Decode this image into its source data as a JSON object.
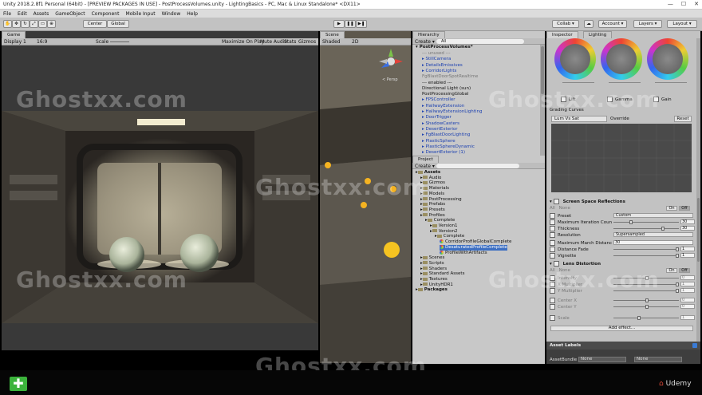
{
  "window": {
    "title": "Unity 2018.2.8f1 Personal (64bit) - [PREVIEW PACKAGES IN USE] - PostProcessVolumes.unity - LightingBasics - PC, Mac & Linux Standalone* <DX11>",
    "controls": [
      "—",
      "☐",
      "✕"
    ]
  },
  "menu": [
    "File",
    "Edit",
    "Assets",
    "GameObject",
    "Component",
    "Mobile Input",
    "Window",
    "Help"
  ],
  "toolbar": {
    "center_label": "Center",
    "global_label": "Global",
    "collab_label": "Collab ▾",
    "account_label": "Account ▾",
    "layers_label": "Layers ▾",
    "layout_label": "Layout ▾"
  },
  "game_view": {
    "tab": "Game",
    "display": "Display 1",
    "aspect": "16:9",
    "scale_label": "Scale",
    "maximize_on_play": "Maximize On Play",
    "mute_audio": "Mute Audio",
    "stats": "Stats",
    "gizmos": "Gizmos"
  },
  "scene_view": {
    "tab": "Scene",
    "shading": "Shaded",
    "mode_2d": "2D",
    "persp": "< Persp"
  },
  "hierarchy": {
    "tab": "Hierarchy",
    "create": "Create ▾",
    "search_placeholder": "All",
    "scene_name": "PostProcessVolumes*",
    "items": [
      {
        "label": "--- unused ---",
        "style": "gray"
      },
      {
        "label": "StillCamera",
        "style": "blue"
      },
      {
        "label": "DetailsEmissives",
        "style": "blue"
      },
      {
        "label": "CorridorLights",
        "style": "blue"
      },
      {
        "label": "FgBlastDoorSpotRealtime",
        "style": "gray"
      },
      {
        "label": "--- enabled ---",
        "style": ""
      },
      {
        "label": "Directional Light (sun)",
        "style": ""
      },
      {
        "label": "PostProcessingGlobal",
        "style": ""
      },
      {
        "label": "FPSController",
        "style": "blue"
      },
      {
        "label": "HallwayExtension",
        "style": "blue"
      },
      {
        "label": "HallwayExtensionLighting",
        "style": "blue"
      },
      {
        "label": "DoorTrigger",
        "style": "blue"
      },
      {
        "label": "ShadowCasters",
        "style": "blue"
      },
      {
        "label": "DesertExterior",
        "style": "blue"
      },
      {
        "label": "FgBlastDoorLighting",
        "style": "blue"
      },
      {
        "label": "PlasticSphere",
        "style": "blue"
      },
      {
        "label": "PlasticSphereDynamic",
        "style": "blue"
      },
      {
        "label": "DesertExterior (1)",
        "style": "blue"
      }
    ]
  },
  "project": {
    "tab": "Project",
    "create": "Create ▾",
    "items": [
      {
        "label": "Assets",
        "indent": 0,
        "bold": true
      },
      {
        "label": "Audio",
        "indent": 1
      },
      {
        "label": "Gizmos",
        "indent": 1
      },
      {
        "label": "Materials",
        "indent": 1
      },
      {
        "label": "Models",
        "indent": 1
      },
      {
        "label": "PostProcessing",
        "indent": 1
      },
      {
        "label": "Prefabs",
        "indent": 1
      },
      {
        "label": "Presets",
        "indent": 1
      },
      {
        "label": "Profiles",
        "indent": 1
      },
      {
        "label": "Complete",
        "indent": 2
      },
      {
        "label": "Version1",
        "indent": 3
      },
      {
        "label": "Version2",
        "indent": 3
      },
      {
        "label": "Complete",
        "indent": 4
      },
      {
        "label": "CorridorProfileGlobalComplete",
        "indent": 5,
        "asset": true
      },
      {
        "label": "DesaturatedProfileComplete",
        "indent": 5,
        "asset": true,
        "selected": true
      },
      {
        "label": "ProfileWithArtifacts",
        "indent": 5,
        "asset": true
      },
      {
        "label": "Scenes",
        "indent": 1
      },
      {
        "label": "Scripts",
        "indent": 1
      },
      {
        "label": "Shaders",
        "indent": 1
      },
      {
        "label": "Standard Assets",
        "indent": 1
      },
      {
        "label": "Textures",
        "indent": 1
      },
      {
        "label": "UnityHDR1",
        "indent": 1
      },
      {
        "label": "Packages",
        "indent": 0,
        "bold": true
      }
    ]
  },
  "inspector": {
    "tab": "Inspector",
    "tab2": "Lighting",
    "wheels": [
      {
        "label": "Lift"
      },
      {
        "label": "Gamma"
      },
      {
        "label": "Gain"
      }
    ],
    "grading_curves": "Grading Curves",
    "curve_mode": "Lum Vs Sat",
    "override": "Override",
    "reset": "Reset",
    "ssr": {
      "title": "Screen Space Reflections",
      "all": "All",
      "none": "None",
      "on": "On",
      "off": "Off",
      "preset_label": "Preset",
      "preset_value": "Custom",
      "max_iter_label": "Maximum Iteration Coun",
      "max_iter_value": "30",
      "thickness_label": "Thickness",
      "thickness_value": "30",
      "resolution_label": "Resolution",
      "resolution_value": "Supersampled",
      "max_march_label": "Maximum March Distanc",
      "max_march_value": "30",
      "distance_fade_label": "Distance Fade",
      "distance_fade_value": "1",
      "vignette_label": "Vignette",
      "vignette_value": "1"
    },
    "lens": {
      "title": "Lens Distortion",
      "all": "All",
      "none": "None",
      "on": "On",
      "off": "Off",
      "rows": [
        "Intensity",
        "X Multiplier",
        "Y Multiplier",
        "Center X",
        "Center Y",
        "Scale"
      ],
      "values": [
        "0",
        "1",
        "1",
        "0",
        "0",
        "1"
      ]
    },
    "add_effect": "Add effect...",
    "asset_labels": "Asset Labels",
    "asset_bundle_label": "AssetBundle",
    "asset_bundle_value": "None",
    "asset_bundle_value2": "None"
  },
  "watermark": "Ghostxx.com",
  "udemy": "Udemy"
}
